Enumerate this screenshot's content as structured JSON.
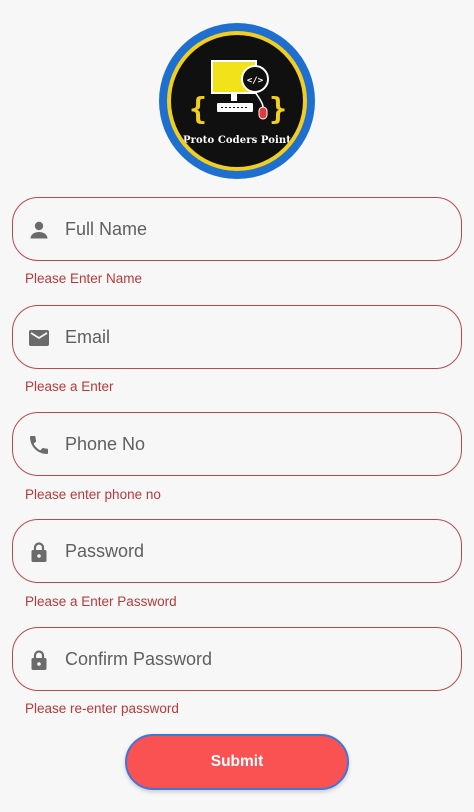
{
  "logo": {
    "text": "Proto Coders Point",
    "icon": "computer-code-logo"
  },
  "fields": [
    {
      "icon": "person-icon",
      "placeholder": "Full Name",
      "value": "",
      "error": "Please Enter Name"
    },
    {
      "icon": "email-icon",
      "placeholder": "Email",
      "value": "",
      "error": "Please a Enter"
    },
    {
      "icon": "phone-icon",
      "placeholder": "Phone No",
      "value": "",
      "error": "Please enter phone no"
    },
    {
      "icon": "lock-icon",
      "placeholder": "Password",
      "value": "",
      "error": "Please a Enter Password"
    },
    {
      "icon": "lock-icon",
      "placeholder": "Confirm Password",
      "value": "",
      "error": "Please re-enter password"
    }
  ],
  "submit": {
    "label": "Submit"
  },
  "colors": {
    "error": "#b73a3a",
    "field_border": "#b94a4a",
    "submit_bg": "#fa5252",
    "submit_border": "#3f76d8",
    "icon": "#6b6b6b",
    "logo_ring_outer": "#1f6fd1",
    "logo_ring_inner": "#f2cf1f"
  }
}
